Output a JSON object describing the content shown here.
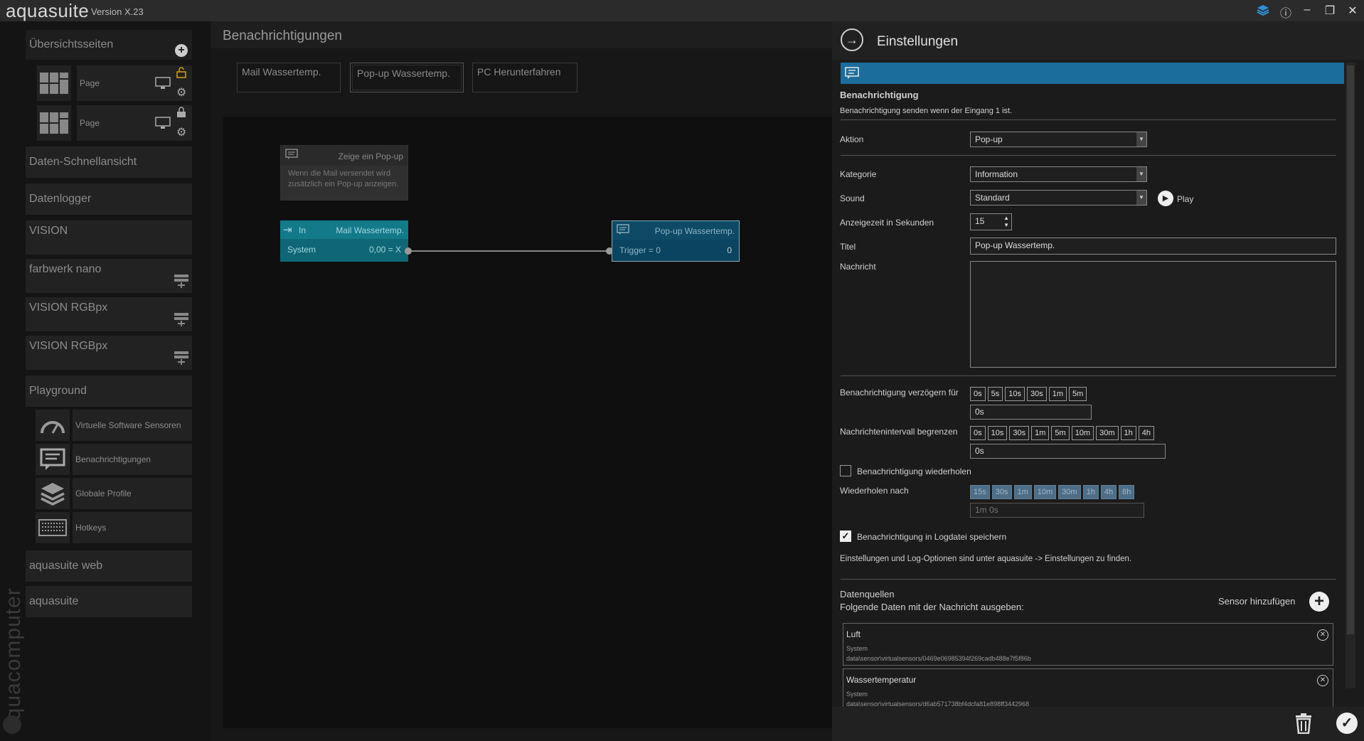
{
  "app": {
    "title": "aquasuite",
    "version": "Version X.23",
    "brand_vertical": "aquacomputer"
  },
  "window_controls": {
    "layers": "layers-icon",
    "info": "ⓘ",
    "minimize": "–",
    "restore": "❐",
    "close": "✕"
  },
  "sidebar": {
    "overview_label": "Übersichtsseiten",
    "pages": [
      {
        "label": "Page"
      },
      {
        "label": "Page"
      }
    ],
    "items": {
      "daten": "Daten-Schnellansicht",
      "datenlogger": "Datenlogger",
      "vision": "VISION",
      "farbwerk": "farbwerk nano",
      "rgbpx1": "VISION RGBpx",
      "rgbpx2": "VISION RGBpx",
      "playground": "Playground",
      "web": "aquasuite web",
      "aquasuite": "aquasuite"
    },
    "playground_items": [
      "Virtuelle Software Sensoren",
      "Benachrichtigungen",
      "Globale Profile",
      "Hotkeys"
    ]
  },
  "main": {
    "title": "Benachrichtigungen",
    "tabs": [
      "Mail Wassertemp.",
      "Pop-up Wassertemp.",
      "PC Herunterfahren"
    ],
    "comment_node": {
      "title": "Zeige ein Pop-up",
      "text1": "Wenn die Mail versendet wird",
      "text2": "zusätzlich ein Pop-up anzeigen."
    },
    "in_node": {
      "label": "In",
      "name": "Mail Wassertemp.",
      "source": "System",
      "value": "0,00 = X"
    },
    "popup_node": {
      "name": "Pop-up Wassertemp.",
      "trigger": "Trigger = 0",
      "value": "0"
    }
  },
  "panel": {
    "title": "Einstellungen",
    "section_title": "Benachrichtigung",
    "section_desc": "Benachrichtigung senden wenn der Eingang 1 ist.",
    "aktion_label": "Aktion",
    "aktion_value": "Pop-up",
    "kategorie_label": "Kategorie",
    "kategorie_value": "Information",
    "sound_label": "Sound",
    "sound_value": "Standard",
    "play_label": "Play",
    "anzeige_label": "Anzeigezeit in Sekunden",
    "anzeige_value": "15",
    "titel_label": "Titel",
    "titel_value": "Pop-up Wassertemp.",
    "nachricht_label": "Nachricht",
    "nachricht_value": "",
    "verzoegern_label": "Benachrichtigung verzögern für",
    "verzoegern_chips": [
      "0s",
      "5s",
      "10s",
      "30s",
      "1m",
      "5m"
    ],
    "verzoegern_value": "0s",
    "intervall_label": "Nachrichtenintervall begrenzen",
    "intervall_chips": [
      "0s",
      "10s",
      "30s",
      "1m",
      "5m",
      "10m",
      "30m",
      "1h",
      "4h"
    ],
    "intervall_value": "0s",
    "wiederholen_label": "Benachrichtigung wiederholen",
    "wiederholen_nach_label": "Wiederholen nach",
    "wiederholen_chips": [
      "15s",
      "30s",
      "1m",
      "10m",
      "30m",
      "1h",
      "4h",
      "8h"
    ],
    "wiederholen_value": "1m 0s",
    "log_label": "Benachrichtigung in Logdatei speichern",
    "info_text": "Einstellungen und Log-Optionen sind unter aquasuite -> Einstellungen zu finden.",
    "datenquellen_label": "Datenquellen",
    "datenquellen_desc": "Folgende Daten mit der Nachricht ausgeben:",
    "sensor_add_label": "Sensor hinzufügen",
    "sources": [
      {
        "name": "Luft",
        "group": "System",
        "path": "data\\sensor\\virtualsensors/0469e06985394f269cadb488e7f5f86b"
      },
      {
        "name": "Wassertemperatur",
        "group": "System",
        "path": "data\\sensor\\virtualsensors/d6ab571738bf4dcfa81e898ff3442968"
      }
    ]
  },
  "colors": {
    "accent": "#1b6d9c",
    "teal": "#137a8a",
    "node_blue": "#0e4a66"
  }
}
